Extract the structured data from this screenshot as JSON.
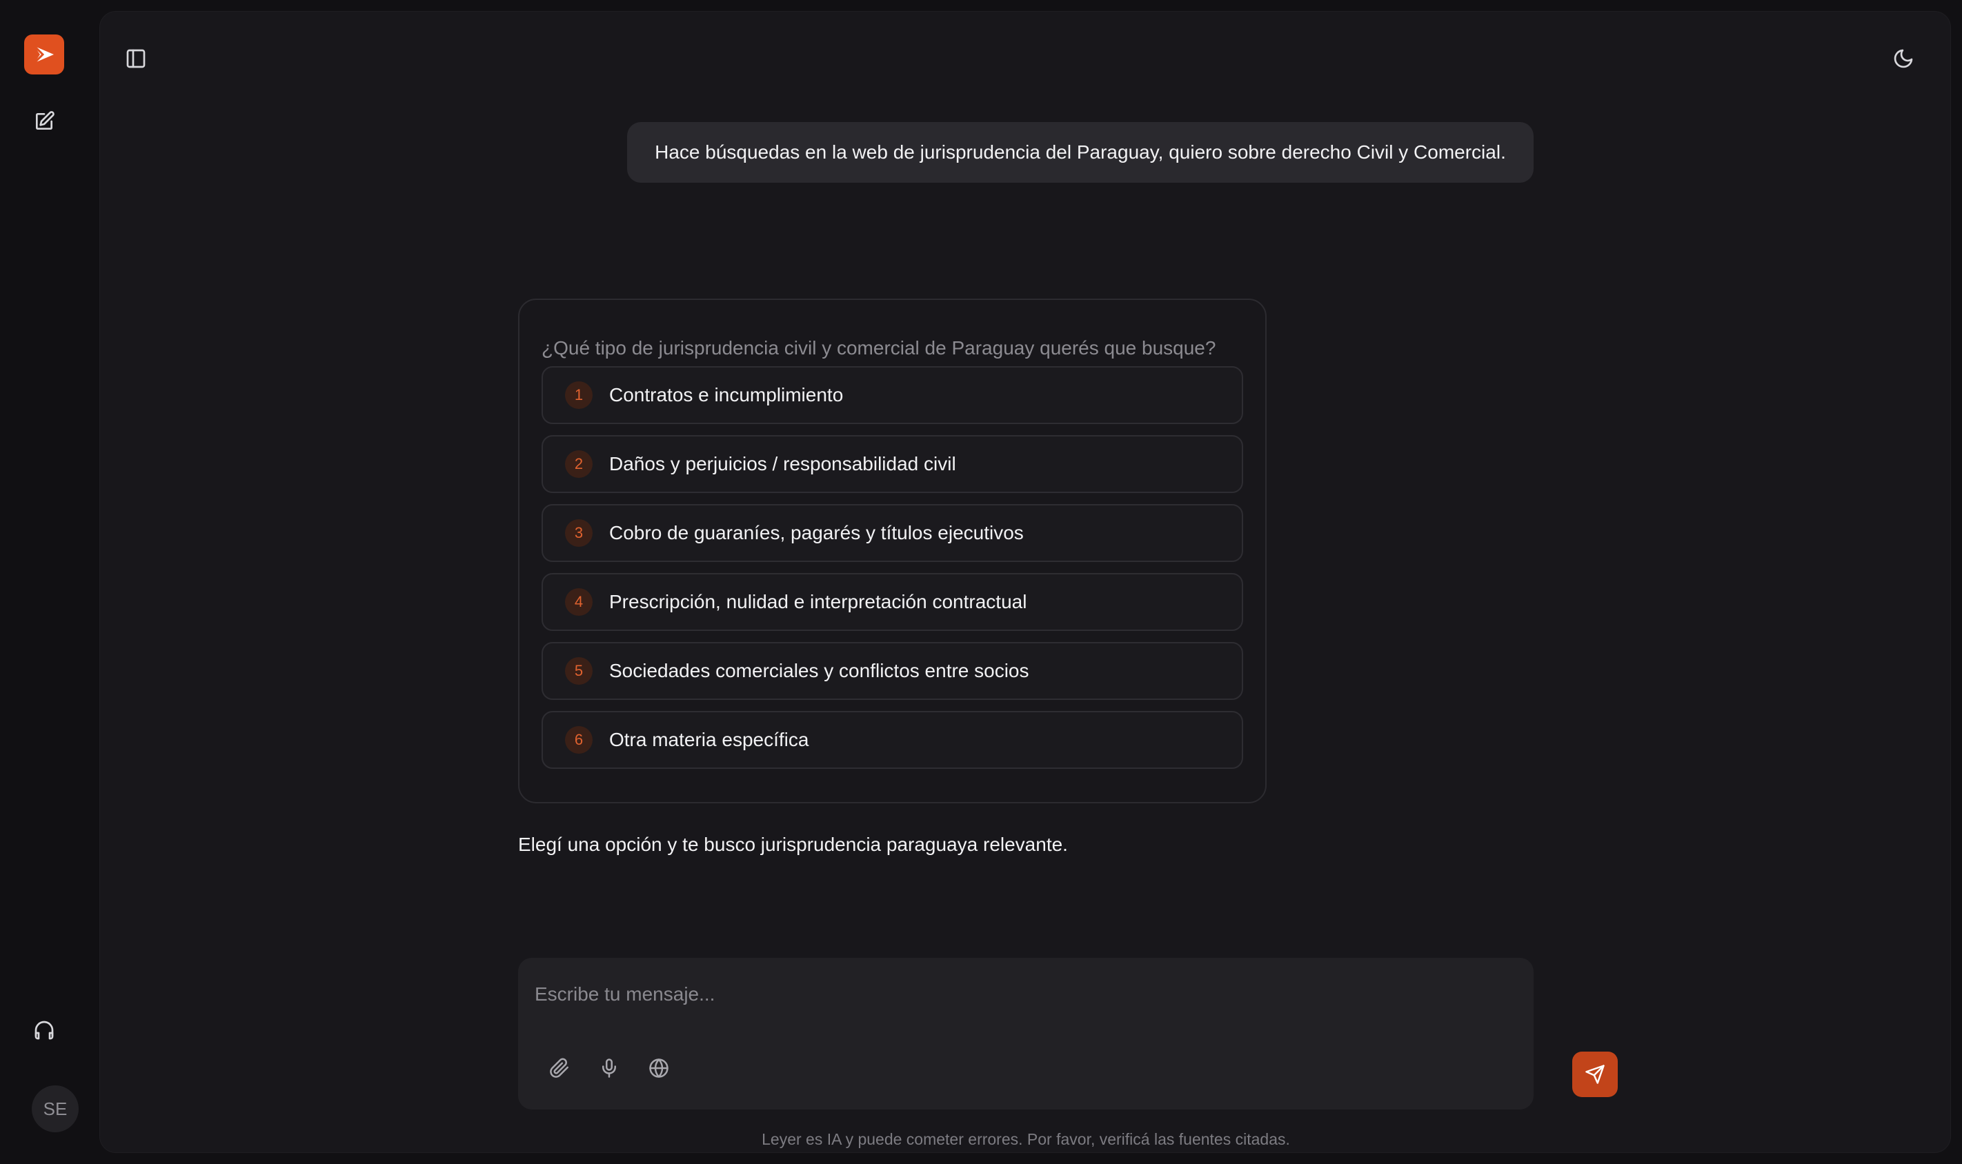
{
  "sidebar": {
    "logo_icon": "leyer-logo-icon",
    "new_chat_icon": "edit-icon",
    "support_icon": "headphones-icon",
    "user_initials": "SE"
  },
  "header": {
    "toggle_sidebar_icon": "sidebar-toggle-icon",
    "theme_icon": "moon-icon"
  },
  "conversation": {
    "user_message": "Hace búsquedas en la web de jurisprudencia del Paraguay, quiero sobre derecho Civil y Comercial.",
    "options_card": {
      "question": "¿Qué tipo de jurisprudencia civil y comercial de Paraguay querés que busque?",
      "options": [
        {
          "number": "1",
          "label": "Contratos e incumplimiento"
        },
        {
          "number": "2",
          "label": "Daños y perjuicios / responsabilidad civil"
        },
        {
          "number": "3",
          "label": "Cobro de guaraníes, pagarés y títulos ejecutivos"
        },
        {
          "number": "4",
          "label": "Prescripción, nulidad e interpretación contractual"
        },
        {
          "number": "5",
          "label": "Sociedades comerciales y conflictos entre socios"
        },
        {
          "number": "6",
          "label": "Otra materia específica"
        }
      ]
    },
    "assistant_message": "Elegí una opción y te busco jurisprudencia paraguaya relevante."
  },
  "composer": {
    "placeholder": "Escribe tu mensaje...",
    "value": "",
    "attach_icon": "paperclip-icon",
    "mic_icon": "microphone-icon",
    "web_icon": "globe-icon",
    "send_icon": "send-icon"
  },
  "footer": {
    "disclaimer": "Leyer es IA y puede cometer errores. Por favor, verificá las fuentes citadas."
  },
  "colors": {
    "accent": "#e0501f",
    "background": "#111013",
    "panel": "#18171b",
    "bubble": "#2a292e"
  }
}
